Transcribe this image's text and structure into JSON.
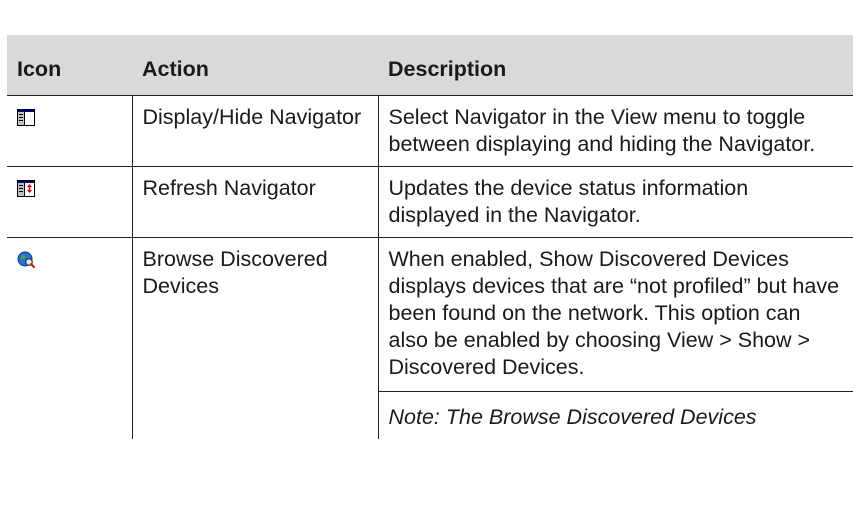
{
  "table": {
    "headers": {
      "icon": "Icon",
      "action": "Action",
      "description": "Description"
    },
    "rows": [
      {
        "icon": "navigator-pane-icon",
        "action": "Display/Hide Navigator",
        "description": "Select Navigator in the View menu to toggle between displaying and hiding the Navigator."
      },
      {
        "icon": "refresh-navigator-icon",
        "action": "Refresh Navigator",
        "description": "Updates the device status information displayed in the Navigator."
      },
      {
        "icon": "globe-magnifier-icon",
        "action": "Browse Discovered Devices",
        "description": "When enabled, Show Discovered Devices displays devices that are “not profiled” but have been found on the network. This option can also be enabled by choosing View > Show > Discovered Devices.",
        "note": "Note: The Browse Discovered Devices"
      }
    ]
  },
  "colors": {
    "header_background": "#d9d9d9",
    "border": "#222222",
    "text": "#1a1a1a"
  }
}
